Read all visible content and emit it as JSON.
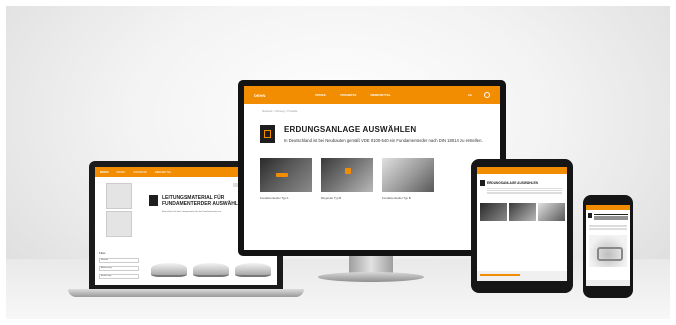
{
  "colors": {
    "brand_orange": "#f28c00",
    "device_black": "#151515"
  },
  "monitor": {
    "nav": {
      "logo": "DEHN",
      "items": [
        "PROFIL",
        "PROJEKTE",
        "MERKZETTEL"
      ],
      "language": "DE",
      "cart_icon": "cart-icon"
    },
    "breadcrumb": "Startseite > Planung > Produkte",
    "title": "ERDUNGSANLAGE AUSWÄHLEN",
    "description": "In Deutschland ist bei Neubauten gemäß VDE 0100-540 ein Fundamenterder nach DIN 18014 zu erstellen.",
    "cards": [
      {
        "label": "Fundamenterder Typ A"
      },
      {
        "label": "Ringerder Typ B"
      },
      {
        "label": "Fundamenterder Typ B"
      }
    ]
  },
  "laptop": {
    "nav": {
      "logo": "DEHN",
      "items": [
        "PROFIL",
        "PROJEKTE",
        "MERKZETTEL"
      ]
    },
    "filter_title": "Filter",
    "fields": [
      "Material",
      "Abmessung",
      "Ausführung"
    ],
    "title": "LEITUNGSMATERIAL FÜR FUNDAMENTERDER AUSWÄHLEN",
    "text": "Bitte wählen Sie das Leitungsmaterial für den Fundamenterder aus."
  },
  "tablet": {
    "title": "ERDUNGSANLAGE AUSWÄHLEN"
  }
}
